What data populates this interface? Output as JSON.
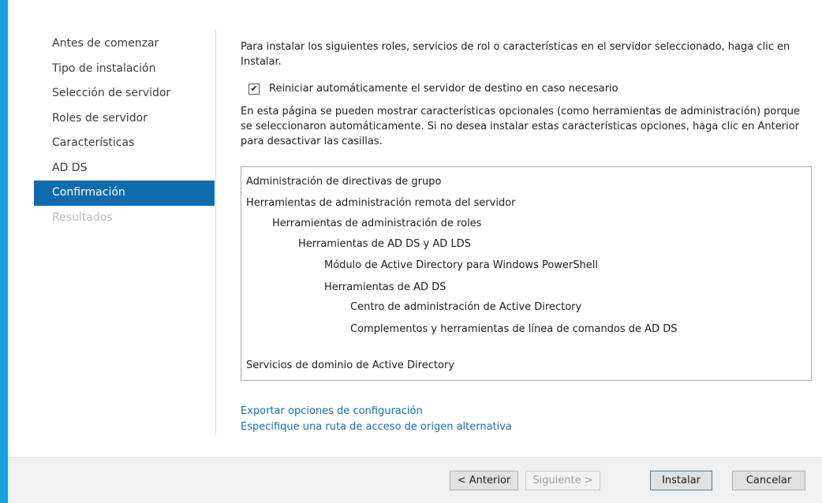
{
  "nav": {
    "items": [
      {
        "label": "Antes de comenzar",
        "state": "normal"
      },
      {
        "label": "Tipo de instalación",
        "state": "normal"
      },
      {
        "label": "Selección de servidor",
        "state": "normal"
      },
      {
        "label": "Roles de servidor",
        "state": "normal"
      },
      {
        "label": "Características",
        "state": "normal"
      },
      {
        "label": "AD DS",
        "state": "normal"
      },
      {
        "label": "Confirmación",
        "state": "active"
      },
      {
        "label": "Resultados",
        "state": "disabled"
      }
    ]
  },
  "content": {
    "intro": "Para instalar los siguientes roles, servicios de rol o características en el servidor seleccionado, haga clic en Instalar.",
    "restart_checkbox": {
      "checked": true,
      "label": "Reiniciar automáticamente el servidor de destino en caso necesario"
    },
    "note": "En esta página se pueden mostrar características opcionales (como herramientas de administración) porque se seleccionaron automáticamente. Si no desea instalar estas características opciones, haga clic en Anterior para desactivar las casillas.",
    "features": [
      {
        "label": "Administración de directivas de grupo",
        "level": 0
      },
      {
        "label": "Herramientas de administración remota del servidor",
        "level": 0
      },
      {
        "label": "Herramientas de administración de roles",
        "level": 1
      },
      {
        "label": "Herramientas de AD DS y AD LDS",
        "level": 2
      },
      {
        "label": "Módulo de Active Directory para Windows PowerShell",
        "level": 3
      },
      {
        "label": "Herramientas de AD DS",
        "level": 3
      },
      {
        "label": "Centro de administración de Active Directory",
        "level": 4
      },
      {
        "label": "Complementos y herramientas de línea de comandos de AD DS",
        "level": 4
      },
      {
        "label": "Servicios de dominio de Active Directory",
        "level": 0
      }
    ],
    "links": {
      "export": "Exportar opciones de configuración",
      "alt_source": "Especifique una ruta de acceso de origen alternativa"
    }
  },
  "footer": {
    "previous": "< Anterior",
    "next": "Siguiente >",
    "install": "Instalar",
    "cancel": "Cancelar"
  },
  "colors": {
    "accent": "#1a9fe0",
    "active_nav": "#0f6bae",
    "link": "#1a6ea8"
  }
}
